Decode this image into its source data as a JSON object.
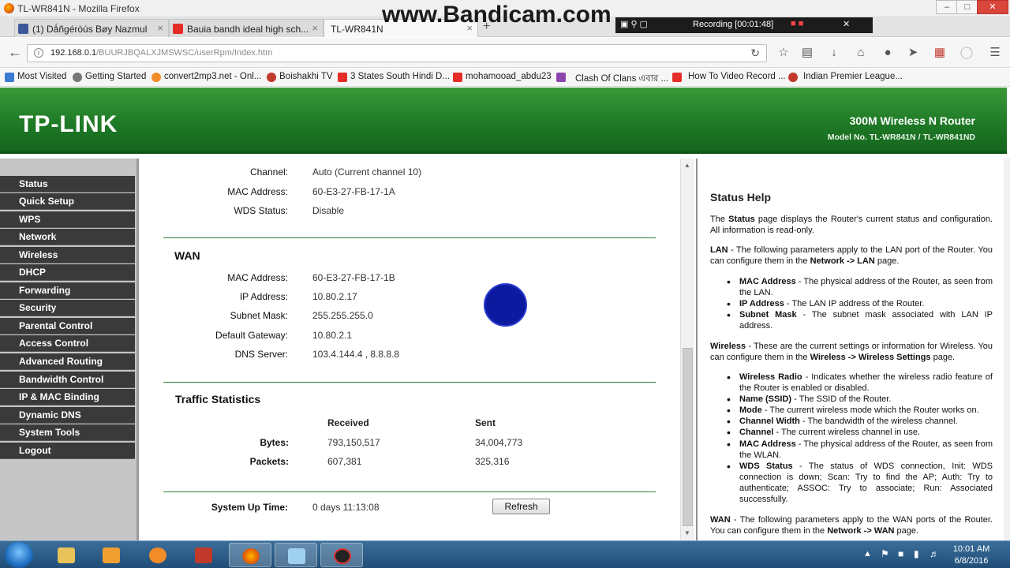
{
  "window": {
    "title": "TL-WR841N - Mozilla Firefox"
  },
  "tabs": [
    {
      "label": "(1) Dǻñgéròús Bøy Nazmul",
      "icon": "facebook-icon",
      "color": "#3b5998"
    },
    {
      "label": "Bauia bandh ideal high sch...",
      "icon": "youtube-icon",
      "color": "#e52d27"
    },
    {
      "label": "TL-WR841N",
      "icon": "page-icon",
      "color": "#ffffff"
    }
  ],
  "url": {
    "host": "192.168.0.1",
    "path": "/BUURJBQALXJMSWSC/userRpm/Index.htm"
  },
  "bookmarks": [
    {
      "label": "Most Visited",
      "color": "#3b7bd4"
    },
    {
      "label": "Getting Started",
      "color": "#777777"
    },
    {
      "label": "convert2mp3.net - Onl...",
      "color": "#f28c28"
    },
    {
      "label": "Boishakhi TV",
      "color": "#c0392b"
    },
    {
      "label": "3 States South Hindi D...",
      "color": "#e52d27"
    },
    {
      "label": "mohamooad_abdu23",
      "color": "#e52d27"
    },
    {
      "label": "Clash Of Clans এবার ...",
      "color": "#8e44ad"
    },
    {
      "label": "How To Video Record ...",
      "color": "#e52d27"
    },
    {
      "label": "Indian Premier League...",
      "color": "#c0392b"
    }
  ],
  "recorder": {
    "watermark": "www.Bandicam.com",
    "status": "Recording [00:01:48]"
  },
  "router": {
    "brand": "TP-LINK",
    "product": "300M Wireless N Router",
    "model": "Model No. TL-WR841N / TL-WR841ND"
  },
  "menu": [
    "Status",
    "Quick Setup",
    "WPS",
    "Network",
    "Wireless",
    "DHCP",
    "Forwarding",
    "Security",
    "Parental Control",
    "Access Control",
    "Advanced Routing",
    "Bandwidth Control",
    "IP & MAC Binding",
    "Dynamic DNS",
    "System Tools",
    "Logout"
  ],
  "wireless": {
    "channel_label": "Channel:",
    "channel": "Auto (Current channel 10)",
    "mac_label": "MAC Address:",
    "mac": "60-E3-27-FB-17-1A",
    "wds_label": "WDS Status:",
    "wds": "Disable"
  },
  "wan": {
    "title": "WAN",
    "mac_label": "MAC Address:",
    "mac": "60-E3-27-FB-17-1B",
    "ip_label": "IP Address:",
    "ip": "10.80.2.17",
    "mask_label": "Subnet Mask:",
    "mask": "255.255.255.0",
    "gw_label": "Default Gateway:",
    "gw": "10.80.2.1",
    "dns_label": "DNS Server:",
    "dns": "103.4.144.4 , 8.8.8.8"
  },
  "traffic": {
    "title": "Traffic Statistics",
    "received_header": "Received",
    "sent_header": "Sent",
    "bytes_label": "Bytes:",
    "bytes_received": "793,150,517",
    "bytes_sent": "34,004,773",
    "packets_label": "Packets:",
    "packets_received": "607,381",
    "packets_sent": "325,316"
  },
  "uptime": {
    "label": "System Up Time:",
    "value": "0 days 11:13:08",
    "refresh": "Refresh"
  },
  "help": {
    "title": "Status Help",
    "intro_a": "The ",
    "intro_b": "Status",
    "intro_c": " page displays the Router's current status and configuration. All information is read-only.",
    "lan_a": "LAN",
    "lan_b": " - The following parameters apply to the LAN port of the Router. You can configure them in the ",
    "lan_c": "Network -> LAN",
    "lan_d": " page.",
    "lan_items": [
      {
        "k": "MAC Address",
        "v": " - The physical address of the Router, as seen from the LAN."
      },
      {
        "k": "IP Address",
        "v": " - The LAN IP address of the Router."
      },
      {
        "k": "Subnet Mask",
        "v": " - The subnet mask associated with LAN IP address."
      }
    ],
    "wl_a": "Wireless",
    "wl_b": " - These are the current settings or information for Wireless. You can configure them in the ",
    "wl_c": "Wireless -> Wireless Settings",
    "wl_d": " page.",
    "wl_items": [
      {
        "k": "Wireless Radio",
        "v": " - Indicates whether the wireless radio feature of the Router is enabled or disabled."
      },
      {
        "k": "Name (SSID)",
        "v": " - The SSID of the Router."
      },
      {
        "k": "Mode",
        "v": " - The current wireless mode which the Router works on."
      },
      {
        "k": "Channel Width",
        "v": " - The bandwidth of the wireless channel."
      },
      {
        "k": "Channel",
        "v": " - The current wireless channel in use."
      },
      {
        "k": "MAC Address",
        "v": " - The physical address of the Router, as seen from the WLAN."
      },
      {
        "k": "WDS Status",
        "v": " - The status of WDS connection, Init: WDS connection is down; Scan: Try to find the AP; Auth: Try to authenticate; ASSOC: Try to associate; Run: Associated successfully."
      }
    ],
    "wan_a": "WAN",
    "wan_b": " - The following parameters apply to the WAN ports of the Router. You can configure them in the ",
    "wan_c": "Network -> WAN",
    "wan_d": " page."
  },
  "clock": {
    "time": "10:01 AM",
    "date": "6/8/2016"
  }
}
